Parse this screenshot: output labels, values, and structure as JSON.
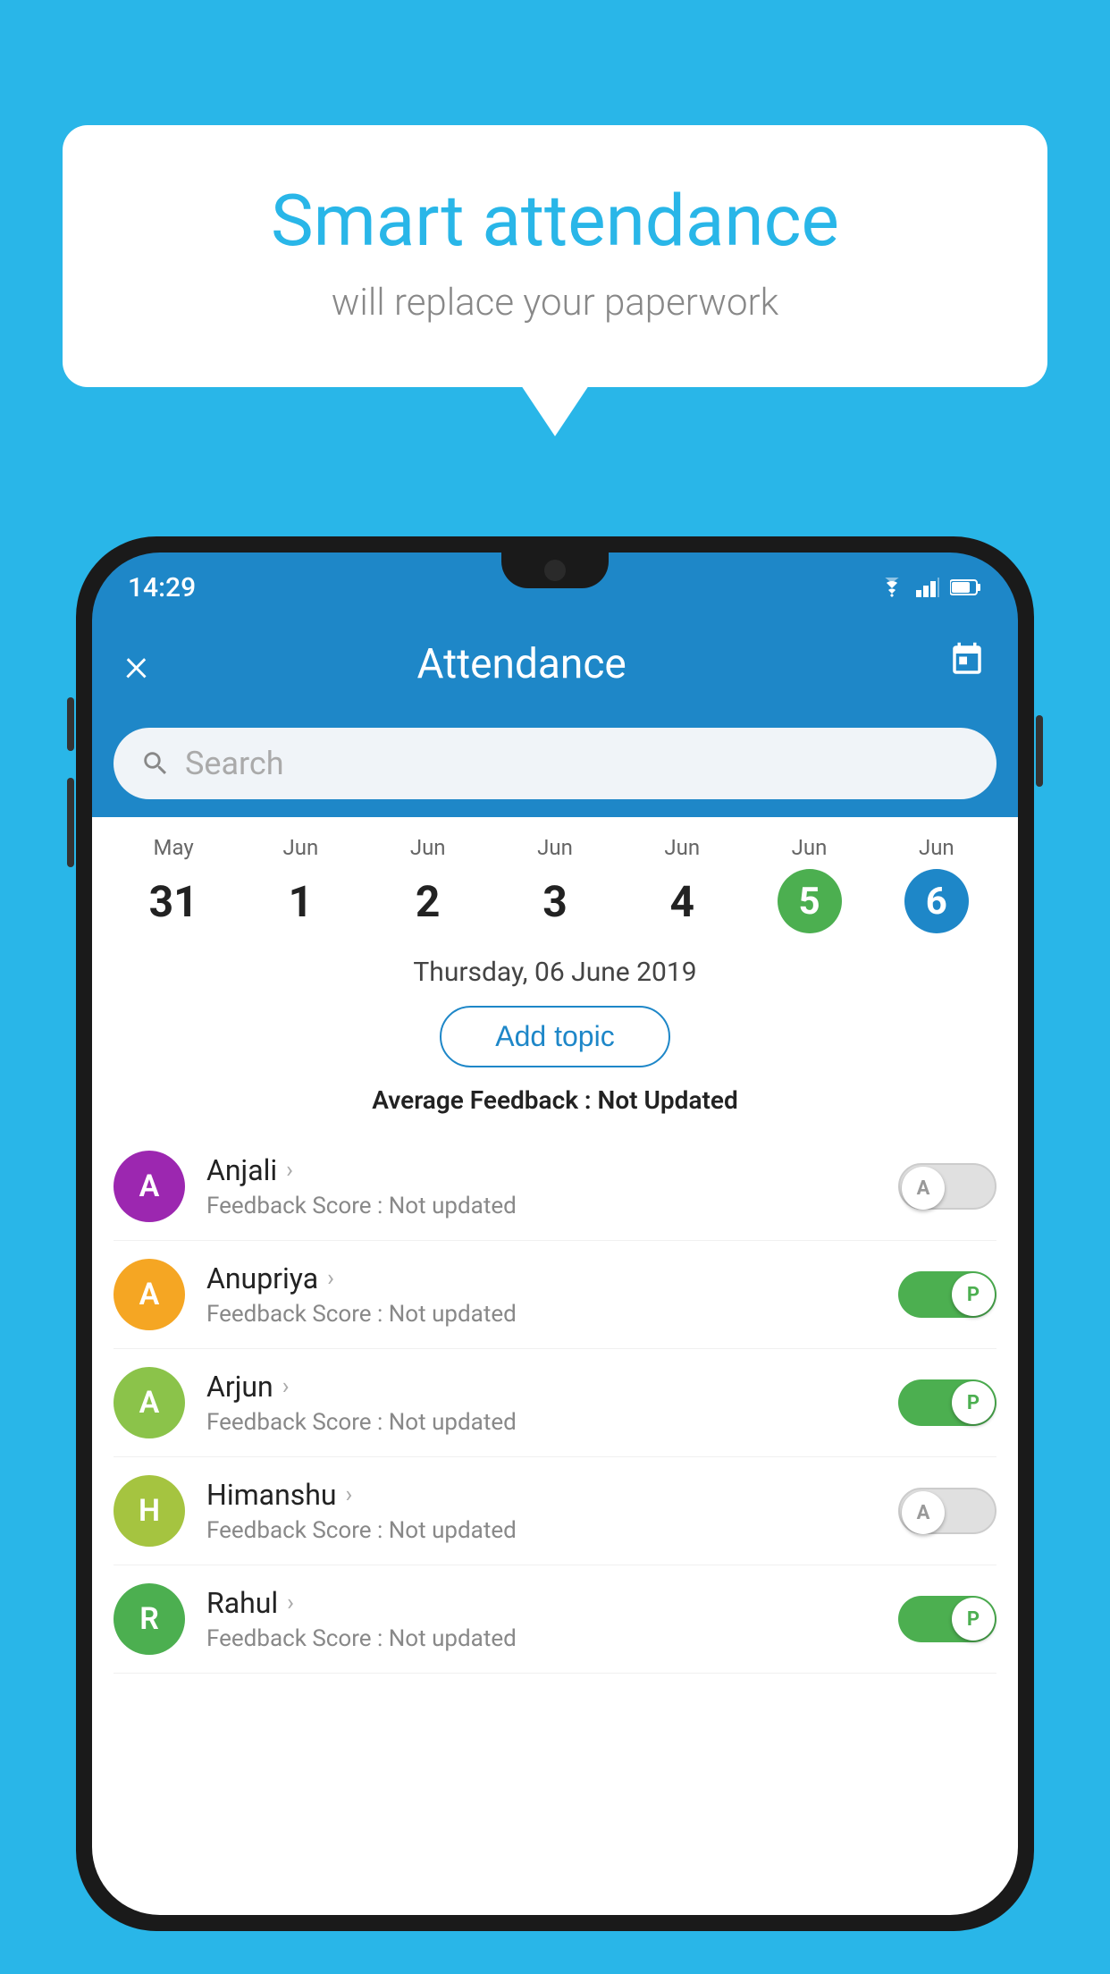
{
  "background_color": "#29b6e8",
  "bubble": {
    "title": "Smart attendance",
    "subtitle": "will replace your paperwork"
  },
  "status_bar": {
    "time": "14:29"
  },
  "app_bar": {
    "title": "Attendance",
    "close_label": "×",
    "calendar_label": "📅"
  },
  "search": {
    "placeholder": "Search"
  },
  "calendar": {
    "days": [
      {
        "month": "May",
        "date": "31",
        "style": "normal"
      },
      {
        "month": "Jun",
        "date": "1",
        "style": "normal"
      },
      {
        "month": "Jun",
        "date": "2",
        "style": "normal"
      },
      {
        "month": "Jun",
        "date": "3",
        "style": "normal"
      },
      {
        "month": "Jun",
        "date": "4",
        "style": "normal"
      },
      {
        "month": "Jun",
        "date": "5",
        "style": "green"
      },
      {
        "month": "Jun",
        "date": "6",
        "style": "blue"
      }
    ],
    "selected_label": "Thursday, 06 June 2019"
  },
  "add_topic_label": "Add topic",
  "avg_feedback": {
    "label": "Average Feedback :",
    "value": "Not Updated"
  },
  "students": [
    {
      "name": "Anjali",
      "avatar_letter": "A",
      "avatar_color": "#9c27b0",
      "feedback_label": "Feedback Score :",
      "feedback_value": "Not updated",
      "toggle": "off",
      "toggle_letter": "A"
    },
    {
      "name": "Anupriya",
      "avatar_letter": "A",
      "avatar_color": "#f5a623",
      "feedback_label": "Feedback Score :",
      "feedback_value": "Not updated",
      "toggle": "on",
      "toggle_letter": "P"
    },
    {
      "name": "Arjun",
      "avatar_letter": "A",
      "avatar_color": "#8bc34a",
      "feedback_label": "Feedback Score :",
      "feedback_value": "Not updated",
      "toggle": "on",
      "toggle_letter": "P"
    },
    {
      "name": "Himanshu",
      "avatar_letter": "H",
      "avatar_color": "#a5c440",
      "feedback_label": "Feedback Score :",
      "feedback_value": "Not updated",
      "toggle": "off",
      "toggle_letter": "A"
    },
    {
      "name": "Rahul",
      "avatar_letter": "R",
      "avatar_color": "#4caf50",
      "feedback_label": "Feedback Score :",
      "feedback_value": "Not updated",
      "toggle": "on",
      "toggle_letter": "P"
    }
  ]
}
